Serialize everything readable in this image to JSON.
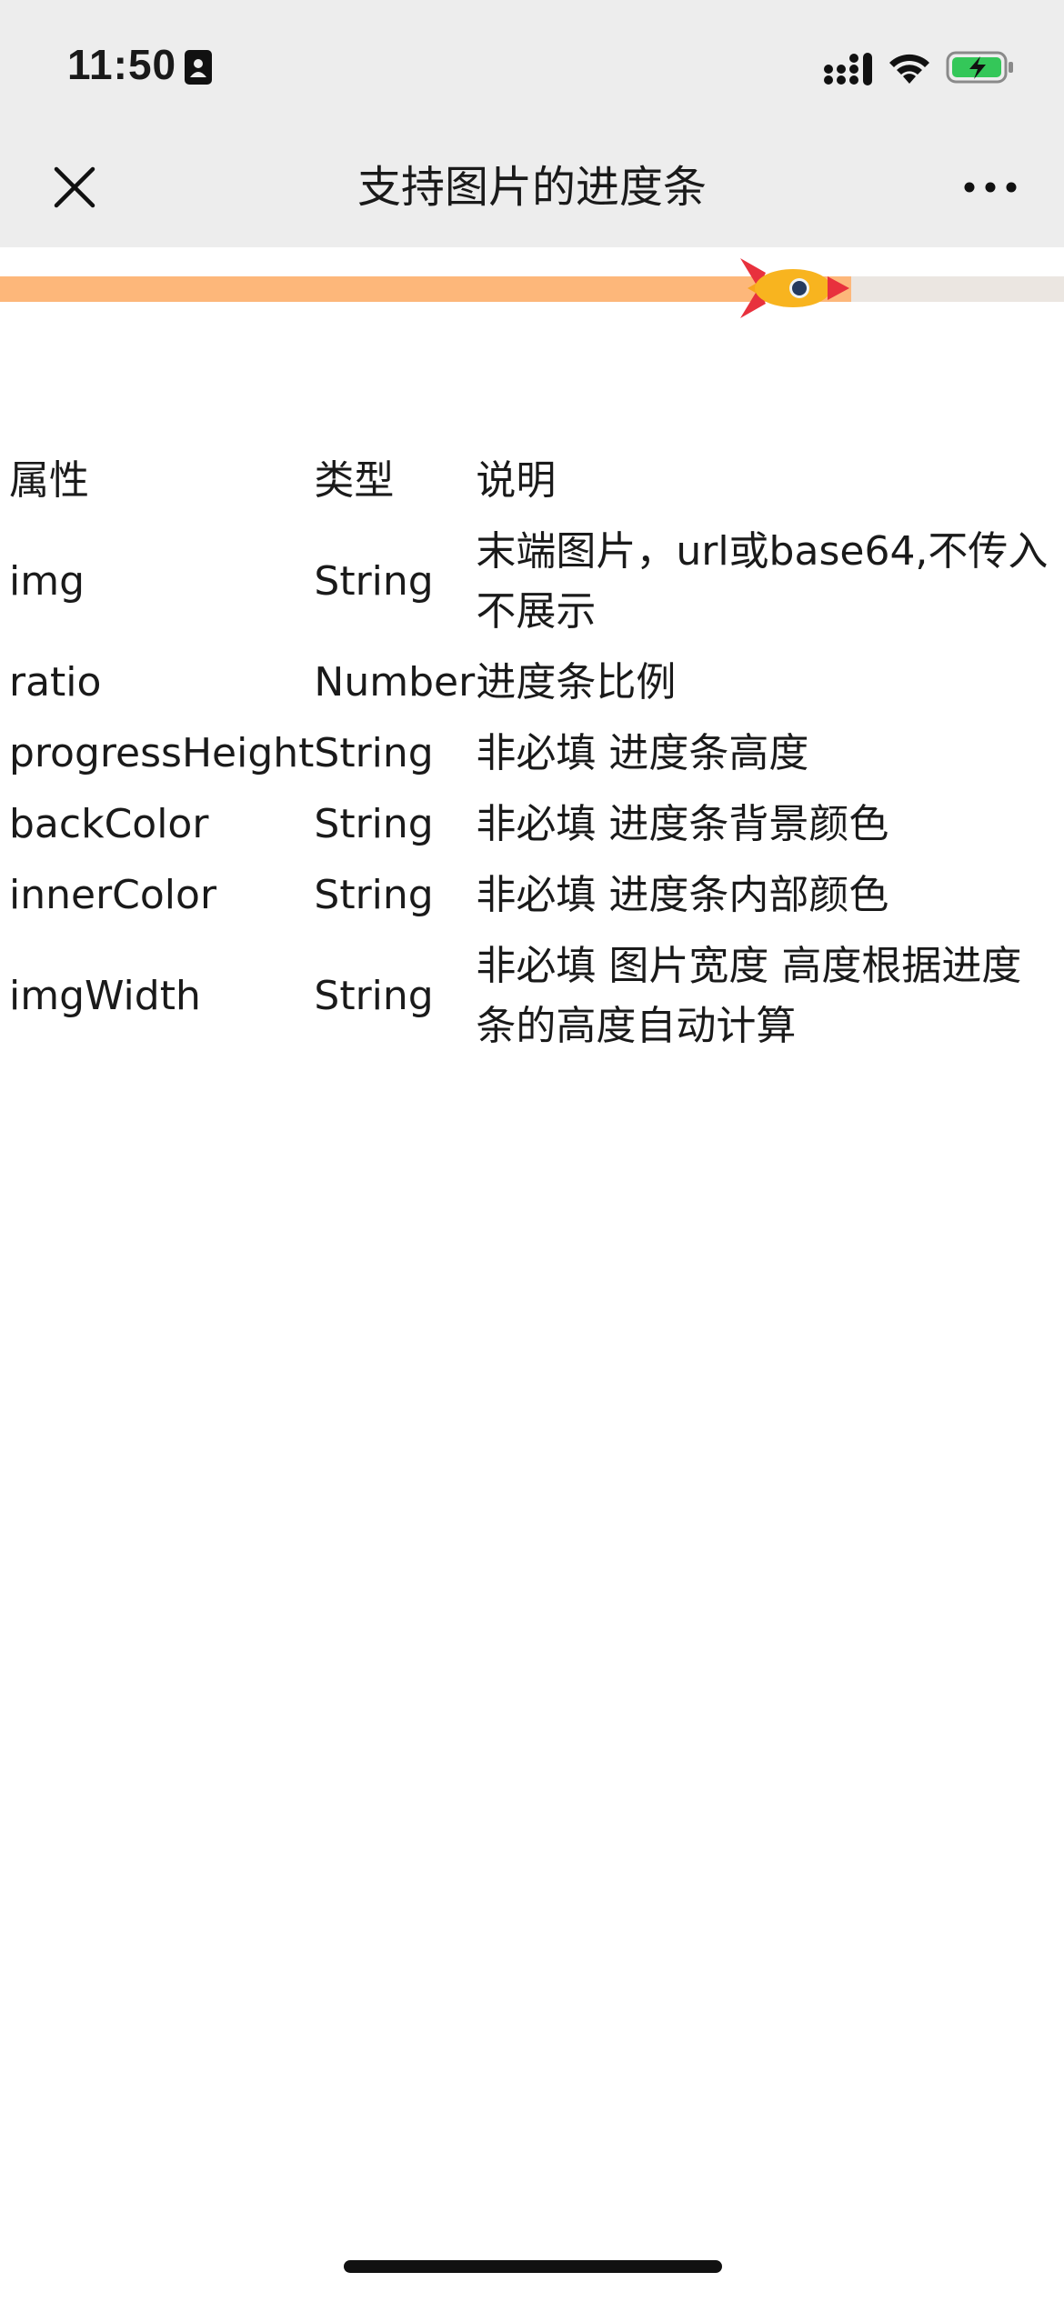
{
  "status_bar": {
    "time": "11:50",
    "icons": [
      "contact-card-icon",
      "cellular-signal-icon",
      "wifi-icon",
      "battery-charging-icon"
    ]
  },
  "nav_bar": {
    "title": "支持图片的进度条",
    "close_icon": "close-icon",
    "more_icon": "more-icon"
  },
  "progress": {
    "ratio": 0.8,
    "back_color": "#ebe6e1",
    "inner_color": "#fdb77a",
    "end_image": "rocket-icon"
  },
  "table": {
    "headers": [
      "属性",
      "类型",
      "说明"
    ],
    "rows": [
      {
        "name": "img",
        "type": "String",
        "desc": "末端图片，url或base64,不传入不展示"
      },
      {
        "name": "ratio",
        "type": "Number",
        "desc": "进度条比例"
      },
      {
        "name": "progressHeight",
        "type": "String",
        "desc": "非必填 进度条高度"
      },
      {
        "name": "backColor",
        "type": "String",
        "desc": "非必填 进度条背景颜色"
      },
      {
        "name": "innerColor",
        "type": "String",
        "desc": "非必填 进度条内部颜色"
      },
      {
        "name": "imgWidth",
        "type": "String",
        "desc": "非必填 图片宽度 高度根据进度条的高度自动计算"
      }
    ]
  }
}
